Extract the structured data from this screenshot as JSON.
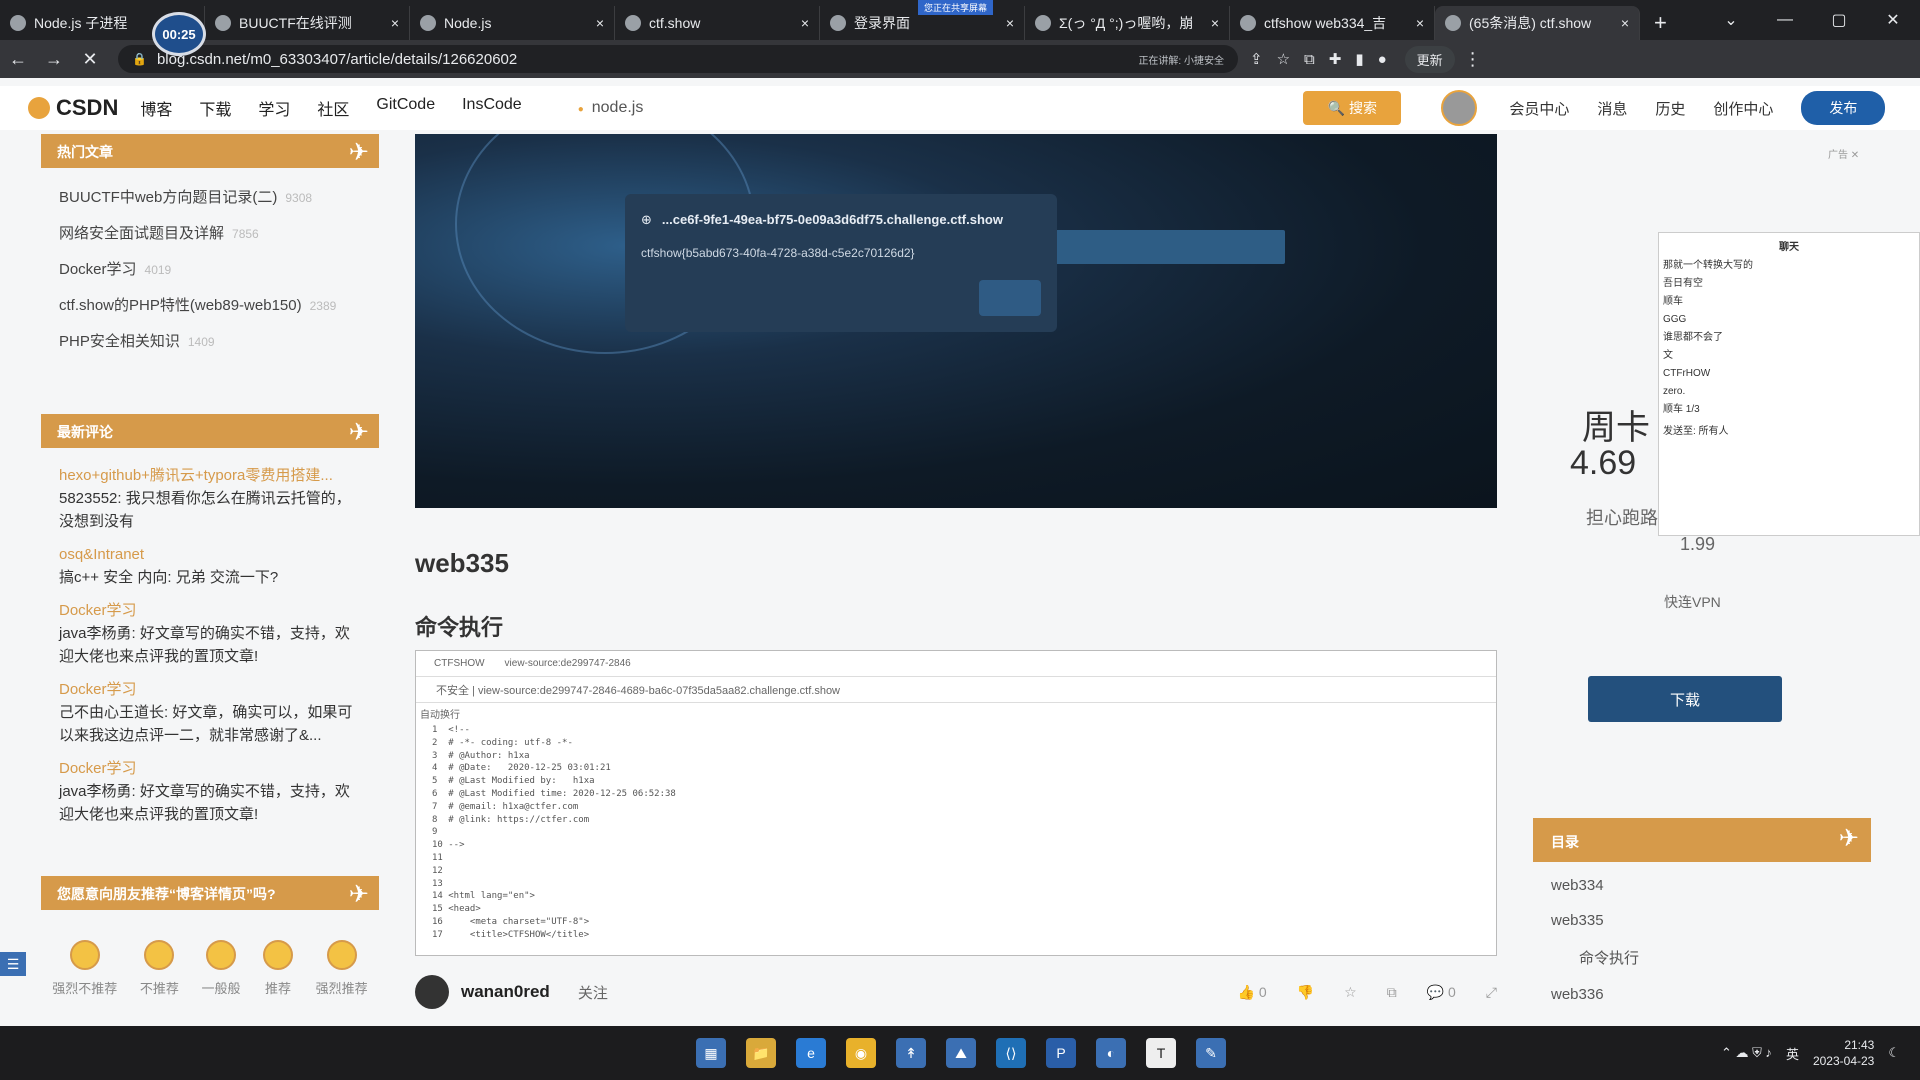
{
  "browser": {
    "recording_time": "00:25",
    "screen_sharing_flag": "您正在共享屏幕",
    "tabs": [
      {
        "title": "Node.js 子进程",
        "close": "×"
      },
      {
        "title": "BUUCTF在线评测",
        "close": "×"
      },
      {
        "title": "Node.js",
        "close": "×"
      },
      {
        "title": "ctf.show",
        "close": "×"
      },
      {
        "title": "登录界面",
        "close": "×"
      },
      {
        "title": "Σ(っ °Д °;)っ喔哟，崩",
        "close": "×"
      },
      {
        "title": "ctfshow web334_吉",
        "close": "×"
      },
      {
        "title": "(65条消息) ctf.show",
        "close": "×"
      }
    ],
    "new_tab": "+",
    "window_controls": [
      "⌄",
      "—",
      "▢",
      "✕"
    ],
    "url": "blog.csdn.net/m0_63303407/article/details/126620602",
    "sharing_indicator": "正在讲解: 小捷安全",
    "update_label": "更新"
  },
  "csdn_header": {
    "logo": "CSDN",
    "nav": [
      "博客",
      "下载",
      "学习",
      "社区",
      "GitCode",
      "InsCode"
    ],
    "search_tag": "node.js",
    "search_button": "搜索",
    "right_nav": [
      "会员中心",
      "消息",
      "历史",
      "创作中心"
    ],
    "create_button": "发布"
  },
  "sidebar": {
    "hot_title": "热门文章",
    "hot_articles": [
      {
        "title": "BUUCTF中web方向题目记录(二)",
        "count": "9308"
      },
      {
        "title": "网络安全面试题目及详解",
        "count": "7856"
      },
      {
        "title": "Docker学习",
        "count": "4019"
      },
      {
        "title": "ctf.show的PHP特性(web89-web150)",
        "count": "2389"
      },
      {
        "title": "PHP安全相关知识",
        "count": "1409"
      }
    ],
    "comments_title": "最新评论",
    "comments": [
      {
        "source": "hexo+github+腾讯云+typora零费用搭建...",
        "text": "5823552: 我只想看你怎么在腾讯云托管的，没想到没有"
      },
      {
        "source": "osq&Intranet",
        "text": "搞c++ 安全 内向: 兄弟 交流一下?"
      },
      {
        "source": "Docker学习",
        "text": "java李杨勇: 好文章写的确实不错，支持，欢迎大佬也来点评我的置顶文章!"
      },
      {
        "source": "Docker学习",
        "text": "己不由心王道长: 好文章，确实可以，如果可以来我这边点评一二，就非常感谢了&..."
      },
      {
        "source": "Docker学习",
        "text": "java李杨勇: 好文章写的确实不错，支持，欢迎大佬也来点评我的置顶文章!"
      }
    ],
    "recommend_title": "您愿意向朋友推荐“博客详情页”吗?",
    "ratings": [
      "强烈不推荐",
      "不推荐",
      "一般般",
      "推荐",
      "强烈推荐"
    ]
  },
  "article": {
    "dialog_host": "...ce6f-9fe1-49ea-bf75-0e09a3d6df75.challenge.ctf.show",
    "dialog_flag": "ctfshow{b5abd673-40fa-4728-a38d-c5e2c70126d2}",
    "heading1": "web335",
    "heading2": "命令执行",
    "shot_tabs": [
      "CTFSHOW",
      "view-source:de299747-2846"
    ],
    "shot_url": "不安全 | view-source:de299747-2846-4689-ba6c-07f35da5aa82.challenge.ctf.show",
    "shot_wrap": "自动换行",
    "source_lines": [
      "1  <!--",
      "2  # -*- coding: utf-8 -*-",
      "3  # @Author: h1xa",
      "4  # @Date:   2020-12-25 03:01:21",
      "5  # @Last Modified by:   h1xa",
      "6  # @Last Modified time: 2020-12-25 06:52:38",
      "7  # @email: h1xa@ctfer.com",
      "8  # @link: https://ctfer.com",
      "9",
      "10 -->",
      "11",
      "12",
      "13",
      "14 <html lang=\"en\">",
      "15 <head>",
      "16     <meta charset=\"UTF-8\">",
      "17     <title>CTFSHOW</title>"
    ],
    "author": "wanan0red",
    "follow": "关注",
    "actions": [
      "👍 0",
      "👎",
      "☆",
      "⧉",
      "💬 0",
      "⤢"
    ]
  },
  "right": {
    "ad_label": "广告",
    "ad_title": "周卡",
    "ad_price": "4.69",
    "ad_sub": "担心跑路",
    "ad_price2": "1.99",
    "ad_vpn": "快连VPN",
    "download_button": "下载",
    "chat_title": "聊天",
    "chat_lines": [
      "那就一个转换大写的",
      "吾日有空",
      "顺车",
      "GGG",
      "谁思都不会了",
      "文",
      "CTFrHOW",
      "zero.",
      "顺车 1/3"
    ],
    "chat_send": "发送至: 所有人",
    "toc_title": "目录",
    "toc": [
      {
        "label": "web334",
        "sub": false
      },
      {
        "label": "web335",
        "sub": false
      },
      {
        "label": "命令执行",
        "sub": true
      },
      {
        "label": "web336",
        "sub": false
      }
    ]
  },
  "taskbar": {
    "apps": [
      "▦",
      "📁",
      "e",
      "◉",
      "↟",
      "⛰",
      "⟨⟩",
      "P",
      "◐",
      "T",
      "✎"
    ],
    "lang": "英",
    "time": "21:43",
    "date": "2023-04-23"
  }
}
